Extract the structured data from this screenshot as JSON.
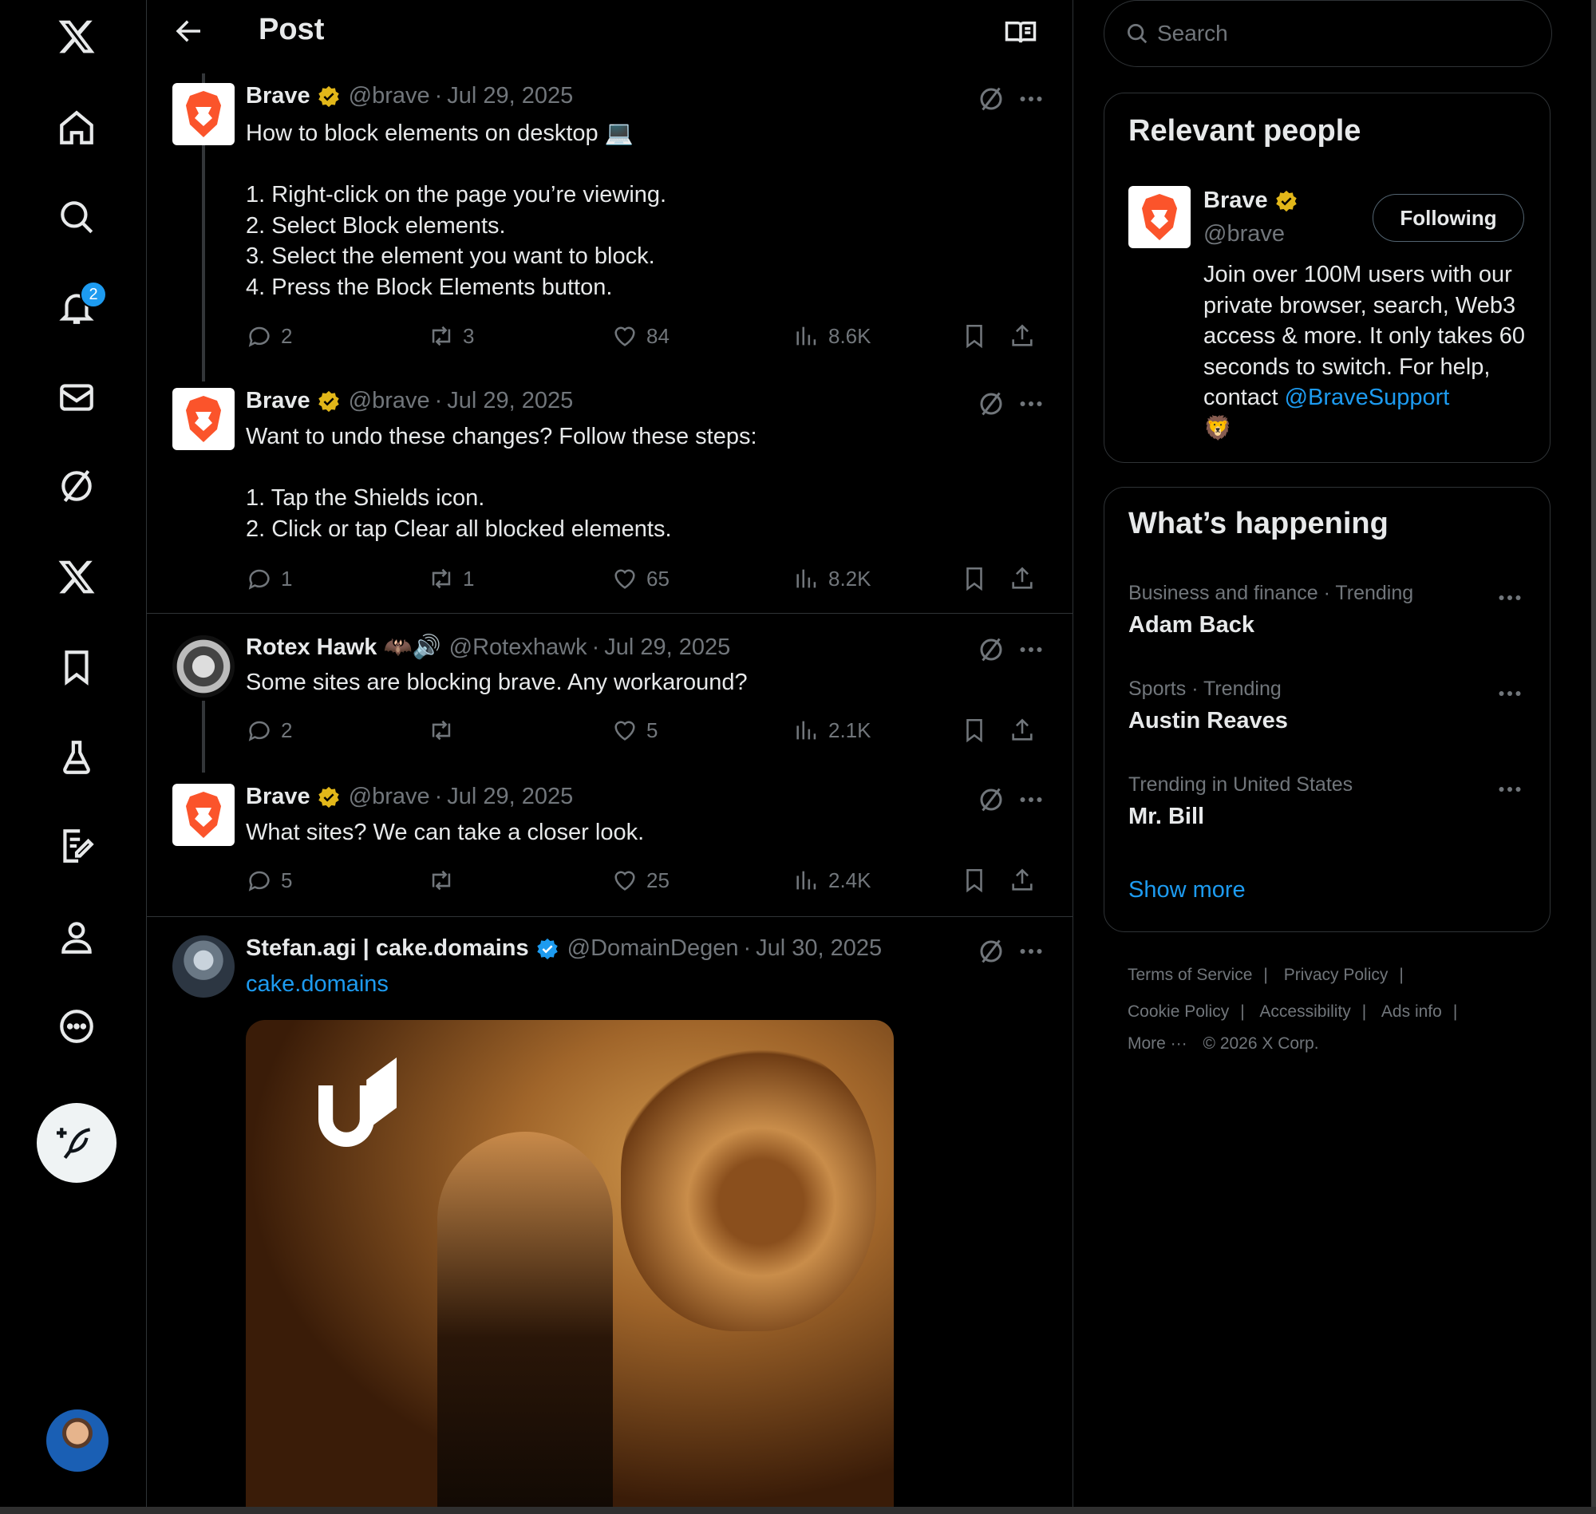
{
  "header": {
    "title": "Post"
  },
  "nav": {
    "notifications_badge": "2"
  },
  "tweets": [
    {
      "name": "Brave",
      "handle": "@brave",
      "date": "Jul 29, 2025",
      "body": "How to block elements on desktop 💻\n\n1. Right-click on the page you’re viewing.\n2. Select Block elements.\n3. Select the element you want to block.\n4. Press the Block Elements button.",
      "replies": "2",
      "reposts": "3",
      "likes": "84",
      "views": "8.6K"
    },
    {
      "name": "Brave",
      "handle": "@brave",
      "date": "Jul 29, 2025",
      "body": "Want to undo these changes? Follow these steps:\n\n1. Tap the Shields icon.\n2. Click or tap Clear all blocked elements.",
      "replies": "1",
      "reposts": "1",
      "likes": "65",
      "views": "8.2K"
    },
    {
      "name": "Rotex Hawk 🦇🔊",
      "handle": "@Rotexhawk",
      "date": "Jul 29, 2025",
      "body": "Some sites are blocking brave. Any workaround?",
      "replies": "2",
      "reposts": "",
      "likes": "5",
      "views": "2.1K"
    },
    {
      "name": "Brave",
      "handle": "@brave",
      "date": "Jul 29, 2025",
      "body": "What sites? We can take a closer look.",
      "replies": "5",
      "reposts": "",
      "likes": "25",
      "views": "2.4K"
    },
    {
      "name": "Stefan.agi | cake.domains",
      "handle": "@DomainDegen",
      "date": "Jul 30, 2025",
      "body": "cake.domains"
    }
  ],
  "meta_sep": "·",
  "search": {
    "placeholder": "Search"
  },
  "relevant": {
    "title": "Relevant people",
    "name": "Brave",
    "handle": "@brave",
    "button": "Following",
    "bio": "Join over 100M users with our private browser, search, Web3 access & more. It only takes 60 seconds to switch. For help, contact ",
    "bio_link": "@BraveSupport",
    "bio_emoji": "🦁"
  },
  "happening": {
    "title": "What’s happening",
    "trends": [
      {
        "category": "Business and finance · Trending",
        "name": "Adam Back"
      },
      {
        "category": "Sports · Trending",
        "name": "Austin Reaves"
      },
      {
        "category": "Trending in United States",
        "name": "Mr. Bill"
      }
    ],
    "show_more": "Show more"
  },
  "footer": {
    "links": [
      "Terms of Service",
      "Privacy Policy",
      "Cookie Policy",
      "Accessibility",
      "Ads info",
      "More ···"
    ],
    "copyright": "© 2026 X Corp.",
    "separator": "|"
  },
  "colors": {
    "accent": "#1d9bf0",
    "background": "#000000",
    "muted": "#71767b",
    "verified_gold": "#e2b719",
    "brave_orange": "#fb542b"
  }
}
